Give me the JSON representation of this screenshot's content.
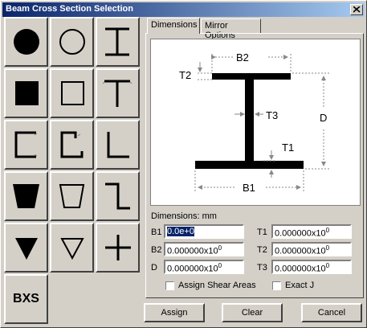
{
  "window": {
    "title": "Beam Cross Section Selection"
  },
  "shapes": {
    "bxs_label": "BXS"
  },
  "tabs": [
    {
      "label": "Dimensions"
    },
    {
      "label": "Mirror Options"
    }
  ],
  "diagram": {
    "labels": {
      "b2": "B2",
      "t2": "T2",
      "t3": "T3",
      "d": "D",
      "t1": "T1",
      "b1": "B1"
    }
  },
  "dimensions": {
    "units_label": "Dimensions: mm",
    "b1": {
      "label": "B1",
      "value": "0.0e+0"
    },
    "b2": {
      "label": "B2",
      "mantissa": "0.000000x10",
      "exponent": "0"
    },
    "d": {
      "label": "D",
      "mantissa": "0.000000x10",
      "exponent": "0"
    },
    "t1": {
      "label": "T1",
      "mantissa": "0.000000x10",
      "exponent": "0"
    },
    "t2": {
      "label": "T2",
      "mantissa": "0.000000x10",
      "exponent": "0"
    },
    "t3": {
      "label": "T3",
      "mantissa": "0.000000x10",
      "exponent": "0"
    }
  },
  "options": {
    "assign_shear_areas": "Assign Shear Areas",
    "exact_j": "Exact J"
  },
  "buttons": {
    "assign": "Assign",
    "clear": "Clear",
    "cancel": "Cancel"
  }
}
